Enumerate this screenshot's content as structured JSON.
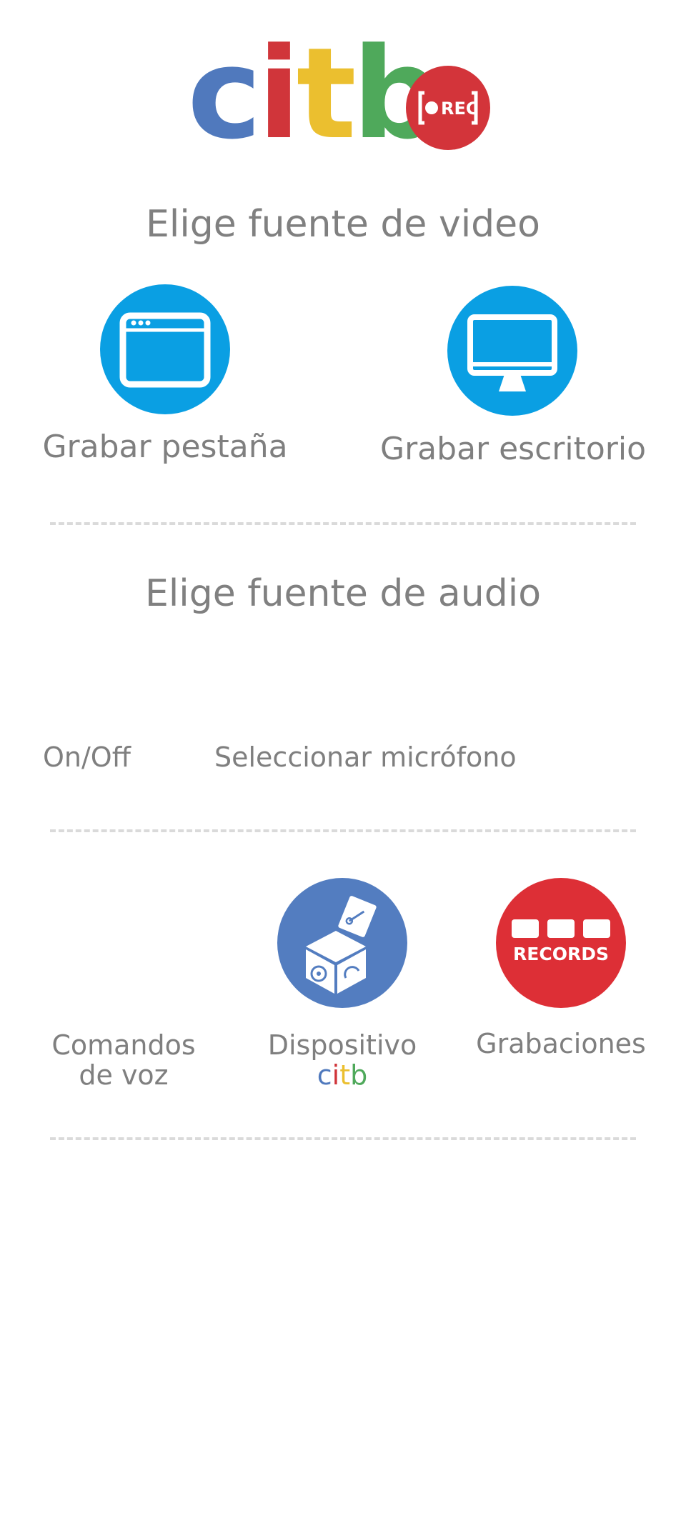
{
  "logo": {
    "letters": [
      "c",
      "i",
      "t",
      "b"
    ],
    "colors": [
      "#5079bd",
      "#d0353a",
      "#ebbf2f",
      "#4fa95b"
    ],
    "badge_text": "REC",
    "badge_color": "#d3343a"
  },
  "video": {
    "heading": "Elige fuente de video",
    "tab": {
      "label": "Grabar pestaña",
      "icon": "browser-window-icon"
    },
    "desktop": {
      "label": "Grabar escritorio",
      "icon": "desktop-monitor-icon"
    },
    "accent": "#0a9fe3"
  },
  "audio": {
    "heading": "Elige fuente de audio",
    "toggle_label": "On/Off",
    "mic_label": "Seleccionar micrófono"
  },
  "tools": {
    "voice": {
      "line1": "Comandos",
      "line2": "de voz"
    },
    "device": {
      "line1": "Dispositivo",
      "brand": [
        "c",
        "i",
        "t",
        "b"
      ],
      "icon": "citb-device-box-icon"
    },
    "recordings": {
      "label": "Grabaciones",
      "badge_text": "RECORDS",
      "icon": "records-icon"
    }
  }
}
